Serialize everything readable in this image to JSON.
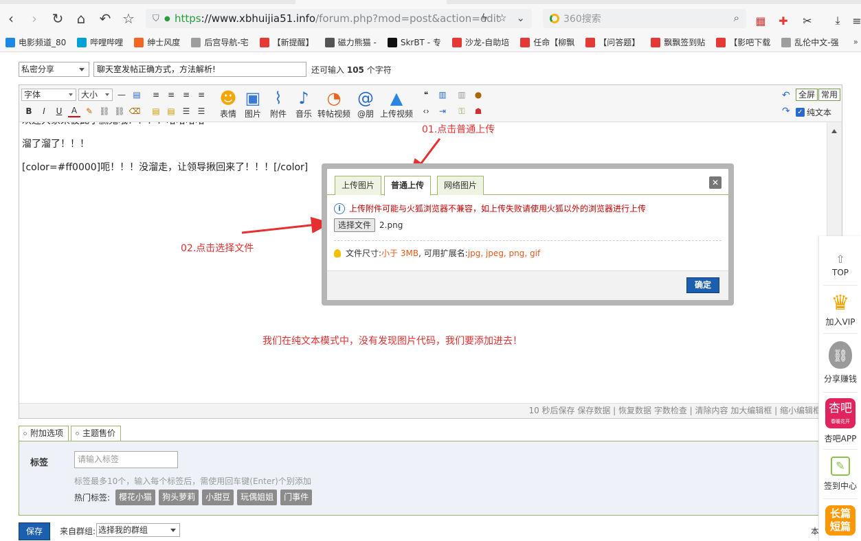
{
  "browser": {
    "url_scheme": "https",
    "url_host": "://www.xbhuijia51.info",
    "url_path": "/forum.php?mod=post&action=edit",
    "search_placeholder": "360搜索"
  },
  "bookmarks": [
    {
      "label": "电影频道_80",
      "color": "#1e88e5"
    },
    {
      "label": "哔哩哔哩",
      "color": "#00a1d6"
    },
    {
      "label": "绅士风度",
      "color": "#f26522"
    },
    {
      "label": "后宫导航-宅",
      "color": "#9e9e9e"
    },
    {
      "label": "【新提醒】",
      "color": "#e53935"
    },
    {
      "label": "磁力熊猫 -",
      "color": "#555555"
    },
    {
      "label": "SkrBT - 专",
      "color": "#111111"
    },
    {
      "label": "沙龙-自助培",
      "color": "#e53935"
    },
    {
      "label": "任命【柳飘",
      "color": "#e53935"
    },
    {
      "label": "【问答题】",
      "color": "#e53935"
    },
    {
      "label": "飘飘签到贴",
      "color": "#e53935"
    },
    {
      "label": "【影吧下载",
      "color": "#e53935"
    },
    {
      "label": "乱伦中文-强",
      "color": "#9e9e9e"
    }
  ],
  "bookmarks_more": "»",
  "form": {
    "category": "私密分享",
    "subject": "聊天室发帖正确方式，方法解析!",
    "remain_prefix": "还可输入",
    "remain_count": "105",
    "remain_suffix": "个字符"
  },
  "toolbar": {
    "font": "字体",
    "size": "大小",
    "buttons": [
      {
        "label": "表情",
        "icon": "smiley-icon"
      },
      {
        "label": "图片",
        "icon": "image-icon"
      },
      {
        "label": "附件",
        "icon": "paperclip-icon"
      },
      {
        "label": "音乐",
        "icon": "music-note-icon"
      },
      {
        "label": "转帖视频",
        "icon": "video-icon"
      },
      {
        "label": "@朋",
        "icon": "at-icon"
      },
      {
        "label": "上传视频",
        "icon": "upload-arrow-icon"
      }
    ],
    "fullscreen": "全屏",
    "common": "常用",
    "plaintext": "纯文本"
  },
  "editor": {
    "lines": [
      "欢迎大家来彼此小腻鬼哦！！！！哈哈哈哈",
      "溜了溜了！！！",
      "[color=#ff0000]呃！！！没溜走，让领导揪回来了！！！[/color]"
    ],
    "status": "10 秒后保存 保存数据 | 恢复数据    字数检查 | 清除内容    加大编辑框 | 缩小编辑框"
  },
  "annotations": {
    "step1": "01.点击普通上传",
    "step2": "02.点击选择文件",
    "note": "我们在纯文本模式中，没有发现图片代码，我们要添加进去！"
  },
  "dialog": {
    "tabs": [
      "上传图片",
      "普通上传",
      "网络图片"
    ],
    "close": "✕",
    "warning": "上传附件可能与火狐浏览器不兼容，如上传失败请使用火狐以外的浏览器进行上传",
    "choose_file": "选择文件",
    "file_name": "2.png",
    "tip_prefix": "文件尺寸: ",
    "tip_size": "小于 3MB",
    "tip_mid": " , 可用扩展名: ",
    "tip_ext": "jpg, jpeg, png, gif",
    "ok": "确定"
  },
  "extra": {
    "tabs": [
      "附加选项",
      "主题售价"
    ],
    "tag_label": "标签",
    "tag_placeholder": "请输入标签",
    "tag_hint": "标签最多10个，输入每个标签后，需使用回车键(Enter)个别添加",
    "hot_label": "热门标签:",
    "hot_tags": [
      "樱花小猫",
      "狗头萝莉",
      "小甜豆",
      "玩偶姐姐",
      "门事件"
    ]
  },
  "bottom": {
    "save": "保存",
    "group_label": "来自群组:",
    "group_select": "选择我的群组",
    "copyright": "本版积"
  },
  "floatbar": {
    "top": "TOP",
    "vip": "加入VIP",
    "share": "分享赚钱",
    "app_logo": "杏吧",
    "app_logo_sub": "春暖花开",
    "app": "杏吧APP",
    "signin": "签到中心",
    "story_1": "长篇",
    "story_2": "短篇"
  }
}
